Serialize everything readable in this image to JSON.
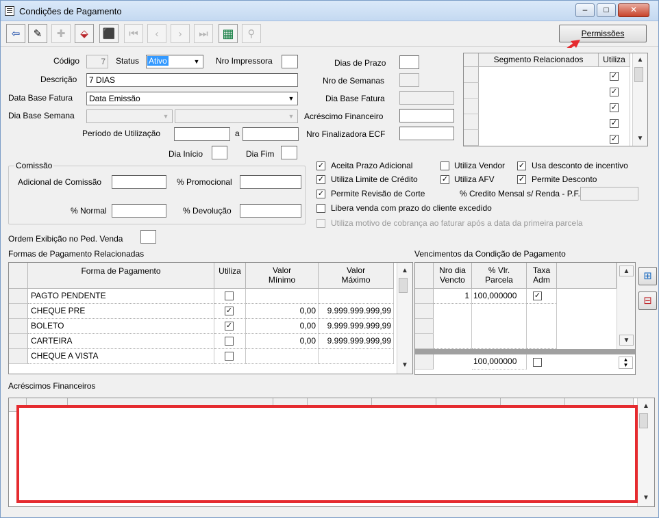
{
  "window": {
    "title": "Condições de Pagamento",
    "min": "–",
    "max": "□",
    "close": "✕"
  },
  "toolbar": {
    "buttons": [
      {
        "name": "exit-icon",
        "glyph": "⇦"
      },
      {
        "name": "edit-icon",
        "glyph": "✎"
      },
      {
        "name": "new-icon",
        "glyph": "✚"
      },
      {
        "name": "save-icon",
        "glyph": "⬙"
      },
      {
        "name": "delete-icon",
        "glyph": "⬛"
      },
      {
        "name": "first-icon",
        "glyph": "⏮"
      },
      {
        "name": "prev-icon",
        "glyph": "‹"
      },
      {
        "name": "next-icon",
        "glyph": "›"
      },
      {
        "name": "last-icon",
        "glyph": "⏭"
      },
      {
        "name": "grid-view-icon",
        "glyph": "▦"
      },
      {
        "name": "search-icon",
        "glyph": "⚲"
      }
    ]
  },
  "permissoes_label": "Permissões",
  "form": {
    "codigo_label": "Código",
    "codigo_value": "7",
    "status_label": "Status",
    "status_value": "Ativo",
    "impressora_label": "Nro Impressora",
    "descricao_label": "Descrição",
    "descricao_value": "7 DIAS",
    "data_base_label": "Data Base Fatura",
    "data_base_value": "Data Emissão",
    "dia_base_semana_label": "Dia Base Semana",
    "periodo_label": "Período de Utilização",
    "a_label": "a",
    "dia_inicio_label": "Dia Início",
    "dia_fim_label": "Dia Fim",
    "dias_prazo_label": "Dias de Prazo",
    "nro_semanas_label": "Nro de Semanas",
    "dia_base_fatura_label": "Dia Base Fatura",
    "acrescimo_label": "Acréscimo Financeiro",
    "finalizadora_label": "Nro Finalizadora ECF",
    "comissao_title": "Comissão",
    "adicional_label": "Adicional de Comissão",
    "promocional_label": "% Promocional",
    "normal_label": "% Normal",
    "devolucao_label": "% Devolução",
    "ordem_label": "Ordem Exibição no Ped. Venda"
  },
  "segmento": {
    "col1": "Segmento Relacionados",
    "col2": "Utiliza",
    "rows": 5
  },
  "checks": {
    "aceita_prazo": "Aceita Prazo Adicional",
    "utiliza_vendor": "Utiliza Vendor",
    "usa_desconto": "Usa desconto de incentivo",
    "limite_credito": "Utiliza Limite de Crédito",
    "utiliza_afv": "Utiliza AFV",
    "permite_desconto": "Permite Desconto",
    "revisao_corte": "Permite Revisão de Corte",
    "credito_mensal": "% Credito Mensal s/ Renda - P.F.",
    "libera_venda": "Libera venda com prazo do cliente excedido",
    "motivo_cobranca": "Utiliza motivo de cobrança ao faturar após a data da primeira parcela"
  },
  "formas": {
    "title": "Formas de Pagamento Relacionadas",
    "headers": [
      "Forma de Pagamento",
      "Utiliza",
      "Valor\nMínimo",
      "Valor\nMáximo"
    ],
    "rows": [
      {
        "forma": "PAGTO PENDENTE",
        "utiliza": "",
        "min": "",
        "max": ""
      },
      {
        "forma": "CHEQUE PRE",
        "utiliza": "✓",
        "min": "0,00",
        "max": "9.999.999.999,99"
      },
      {
        "forma": "BOLETO",
        "utiliza": "✓",
        "min": "0,00",
        "max": "9.999.999.999,99"
      },
      {
        "forma": "CARTEIRA",
        "utiliza": "",
        "min": "0,00",
        "max": "9.999.999.999,99"
      },
      {
        "forma": "CHEQUE A VISTA",
        "utiliza": "",
        "min": "",
        "max": ""
      }
    ]
  },
  "vencimentos": {
    "title": "Vencimentos da Condição de Pagamento",
    "headers": [
      "Nro dia\nVencto",
      "% Vlr.\nParcela",
      "Taxa\nAdm"
    ],
    "row": {
      "dia": "1",
      "parcela": "100,000000",
      "taxa": "✓"
    },
    "total": "100,000000"
  },
  "acrescimos": {
    "title": "Acréscimos Financeiros"
  }
}
